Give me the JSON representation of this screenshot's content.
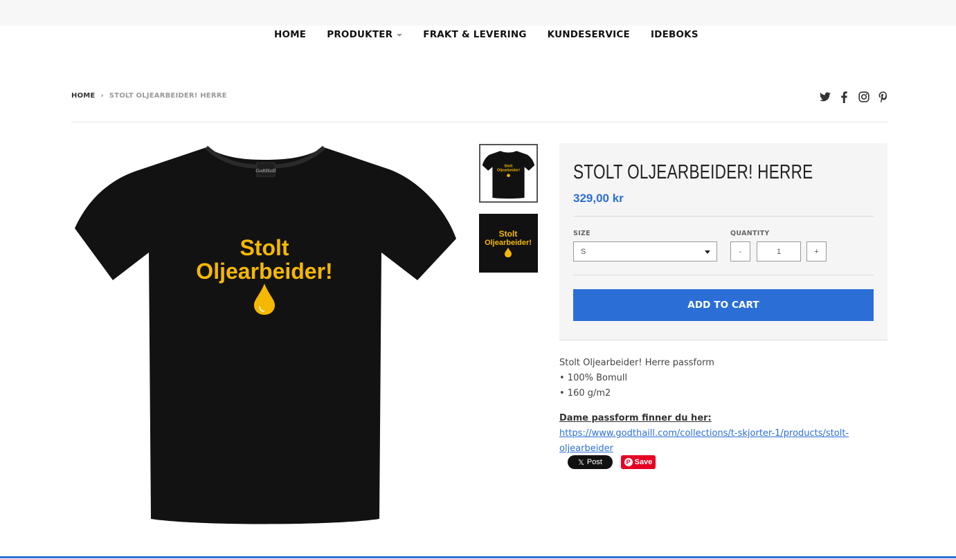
{
  "nav": {
    "items": [
      {
        "label": "HOME"
      },
      {
        "label": "PRODUKTER"
      },
      {
        "label": "FRAKT & LEVERING"
      },
      {
        "label": "KUNDESERVICE"
      },
      {
        "label": "IDEBOKS"
      }
    ]
  },
  "breadcrumb": {
    "home": "HOME",
    "separator": "›",
    "current": "STOLT OLJEARBEIDER! HERRE"
  },
  "social": [
    "twitter-icon",
    "facebook-icon",
    "instagram-icon",
    "pinterest-icon"
  ],
  "product": {
    "shirt_text_line1": "Stolt",
    "shirt_text_line2": "Oljearbeider!",
    "title": "STOLT OLJEARBEIDER! HERRE",
    "price": "329,00 kr",
    "size_label": "SIZE",
    "size_value": "S",
    "quantity_label": "QUANTITY",
    "quantity_minus": "-",
    "quantity_value": "1",
    "quantity_plus": "+",
    "add_to_cart": "ADD TO CART"
  },
  "description": {
    "line1": "Stolt Oljearbeider! Herre passform",
    "line2": "• 100% Bomull",
    "line3": "• 160 g/m2",
    "ladies_label": "Dame passform finner du her:",
    "ladies_link": "https://www.godthaill.com/collections/t-skjorter-1/products/stolt-oljearbeider"
  },
  "share": {
    "x_post": "Post",
    "x_logo": "𝕏",
    "pin_save": "Save",
    "pin_logo": "P"
  },
  "colors": {
    "accent": "#2b6fd6",
    "shirt": "#111111",
    "print": "#f5b800"
  }
}
